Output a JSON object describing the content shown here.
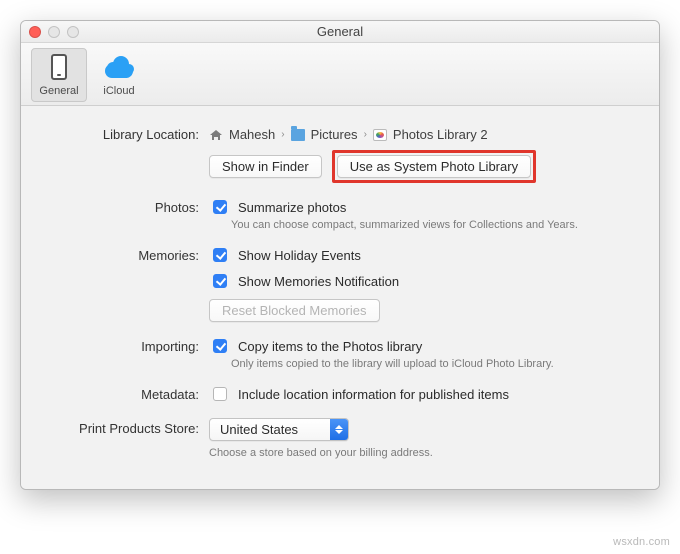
{
  "window": {
    "title": "General"
  },
  "toolbar": {
    "tabs": [
      {
        "label": "General",
        "active": true
      },
      {
        "label": "iCloud",
        "active": false
      }
    ]
  },
  "labels": {
    "library_location": "Library Location:",
    "photos": "Photos:",
    "memories": "Memories:",
    "importing": "Importing:",
    "metadata": "Metadata:",
    "print_products_store": "Print Products Store:"
  },
  "library": {
    "crumbs": [
      "Mahesh",
      "Pictures",
      "Photos Library 2"
    ],
    "show_in_finder": "Show in Finder",
    "use_as_system": "Use as System Photo Library"
  },
  "photos": {
    "summarize_label": "Summarize photos",
    "summarize_checked": true,
    "summarize_hint": "You can choose compact, summarized views for Collections and Years."
  },
  "memories": {
    "holiday_label": "Show Holiday Events",
    "holiday_checked": true,
    "notification_label": "Show Memories Notification",
    "notification_checked": true,
    "reset_label": "Reset Blocked Memories"
  },
  "importing": {
    "copy_label": "Copy items to the Photos library",
    "copy_checked": true,
    "copy_hint": "Only items copied to the library will upload to iCloud Photo Library."
  },
  "metadata": {
    "include_location_label": "Include location information for published items",
    "include_location_checked": false
  },
  "store": {
    "selected": "United States",
    "hint": "Choose a store based on your billing address."
  },
  "watermark": "wsxdn.com"
}
